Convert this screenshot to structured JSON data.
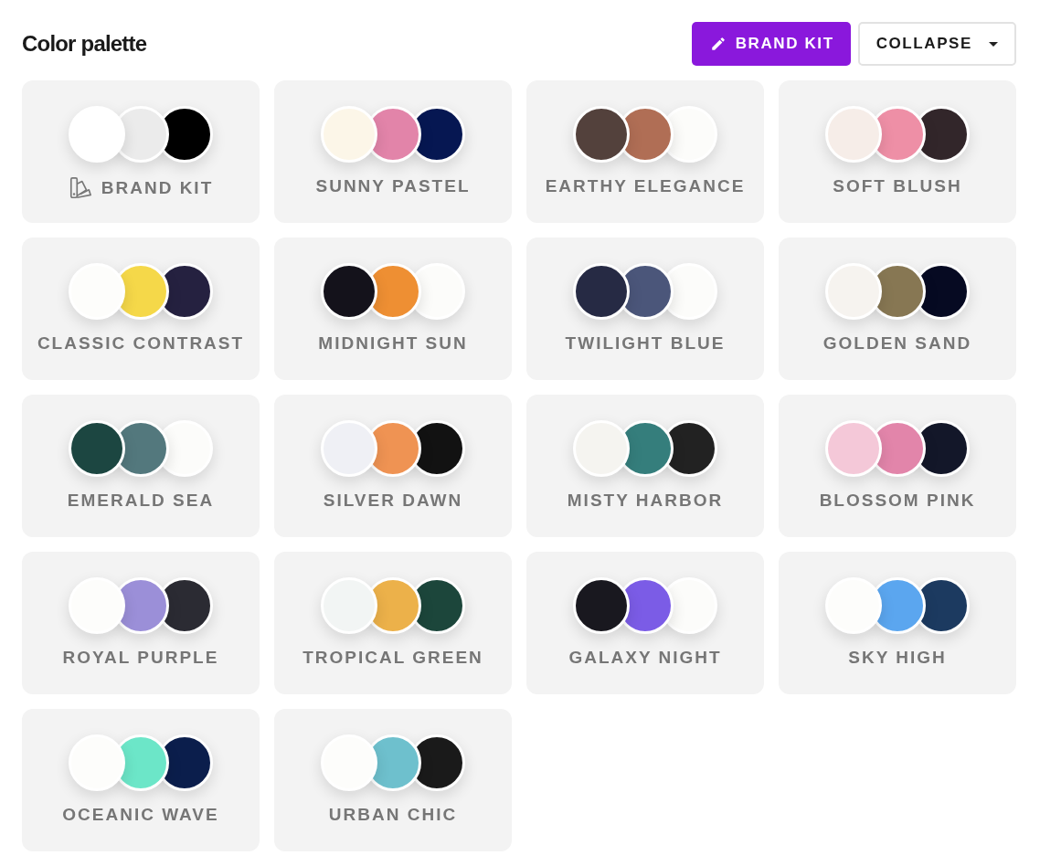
{
  "header": {
    "title": "Color palette",
    "brand_kit_button": "BRAND KIT",
    "collapse_button": "COLLAPSE"
  },
  "palettes": [
    {
      "name": "BRAND KIT",
      "kind": "brand",
      "swatches": [
        {
          "color": "#ffffff"
        },
        {
          "color": "#ebebeb"
        },
        {
          "color": "#000000"
        }
      ]
    },
    {
      "name": "SUNNY PASTEL",
      "kind": "preset",
      "swatches": [
        {
          "color": "#fcf6e8"
        },
        {
          "color": "#e284a9"
        },
        {
          "color": "#061752"
        }
      ]
    },
    {
      "name": "EARTHY ELEGANCE",
      "kind": "preset",
      "swatches": [
        {
          "color": "#53413c"
        },
        {
          "color": "#b06e55"
        },
        {
          "color": "#fcfcfa"
        }
      ]
    },
    {
      "name": "SOFT BLUSH",
      "kind": "preset",
      "swatches": [
        {
          "color": "#f6ede8"
        },
        {
          "color": "#ee8fa6"
        },
        {
          "color": "#32262a"
        }
      ]
    },
    {
      "name": "CLASSIC CONTRAST",
      "kind": "preset",
      "swatches": [
        {
          "color": "#fdfdfb"
        },
        {
          "color": "#f5d849"
        },
        {
          "color": "#252140"
        }
      ]
    },
    {
      "name": "MIDNIGHT SUN",
      "kind": "preset",
      "swatches": [
        {
          "color": "#14121b"
        },
        {
          "color": "#ee8f33"
        },
        {
          "color": "#fcfcfa"
        }
      ]
    },
    {
      "name": "TWILIGHT BLUE",
      "kind": "preset",
      "swatches": [
        {
          "color": "#262a44"
        },
        {
          "color": "#4b567a"
        },
        {
          "color": "#fcfcfa"
        }
      ]
    },
    {
      "name": "GOLDEN SAND",
      "kind": "preset",
      "swatches": [
        {
          "color": "#f6f3ef"
        },
        {
          "color": "#877753"
        },
        {
          "color": "#060a22"
        }
      ]
    },
    {
      "name": "EMERALD SEA",
      "kind": "preset",
      "swatches": [
        {
          "color": "#1c4641"
        },
        {
          "color": "#53787d"
        },
        {
          "color": "#fcfcfa"
        }
      ]
    },
    {
      "name": "SILVER DAWN",
      "kind": "preset",
      "swatches": [
        {
          "color": "#eff0f5"
        },
        {
          "color": "#ef9353"
        },
        {
          "color": "#121212"
        }
      ]
    },
    {
      "name": "MISTY HARBOR",
      "kind": "preset",
      "swatches": [
        {
          "color": "#f5f4f0"
        },
        {
          "color": "#357e7c"
        },
        {
          "color": "#222222"
        }
      ]
    },
    {
      "name": "BLOSSOM PINK",
      "kind": "preset",
      "swatches": [
        {
          "color": "#f4c8d8"
        },
        {
          "color": "#e285aa"
        },
        {
          "color": "#131729"
        }
      ]
    },
    {
      "name": "ROYAL PURPLE",
      "kind": "preset",
      "swatches": [
        {
          "color": "#fdfdfb"
        },
        {
          "color": "#9b8fd8"
        },
        {
          "color": "#2b2b33"
        }
      ]
    },
    {
      "name": "TROPICAL GREEN",
      "kind": "preset",
      "swatches": [
        {
          "color": "#f2f5f4"
        },
        {
          "color": "#ecb14a"
        },
        {
          "color": "#1c463b"
        }
      ]
    },
    {
      "name": "GALAXY NIGHT",
      "kind": "preset",
      "swatches": [
        {
          "color": "#19181f"
        },
        {
          "color": "#7b5ce6"
        },
        {
          "color": "#fcfcfa"
        }
      ]
    },
    {
      "name": "SKY HIGH",
      "kind": "preset",
      "swatches": [
        {
          "color": "#fdfdfb"
        },
        {
          "color": "#5ba6ef"
        },
        {
          "color": "#1c3a60"
        }
      ]
    },
    {
      "name": "OCEANIC WAVE",
      "kind": "preset",
      "swatches": [
        {
          "color": "#fdfdfb"
        },
        {
          "color": "#6ce6c8"
        },
        {
          "color": "#0b1e4c"
        }
      ]
    },
    {
      "name": "URBAN CHIC",
      "kind": "preset",
      "swatches": [
        {
          "color": "#fdfdfb"
        },
        {
          "color": "#6ec0cd"
        },
        {
          "color": "#1a1a1a"
        }
      ]
    }
  ]
}
